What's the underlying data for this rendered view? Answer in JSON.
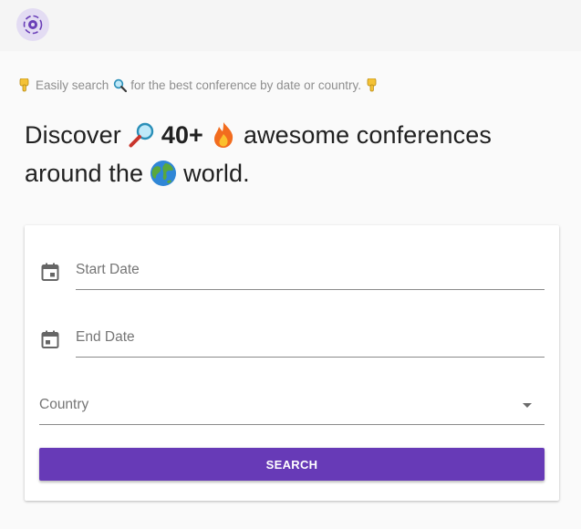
{
  "app": {
    "logo_icon": "atom-logo-icon",
    "accent_color": "#673ab7"
  },
  "tagline": {
    "part1": "Easily search",
    "part2": "for the best conference by date or country.",
    "icons": [
      "pointing-down-icon",
      "magnifier-icon",
      "pointing-down-icon"
    ]
  },
  "headline": {
    "word_discover": "Discover",
    "count": "40+",
    "word_awesome": "awesome conferences",
    "word_around": "around the",
    "word_world": "world.",
    "icons": [
      "magnifier-icon",
      "fire-icon",
      "globe-icon"
    ]
  },
  "form": {
    "start_date_placeholder": "Start Date",
    "end_date_placeholder": "End Date",
    "country_placeholder": "Country",
    "search_label": "SEARCH",
    "icons": [
      "calendar-icon",
      "calendar-icon",
      "dropdown-arrow-icon"
    ]
  }
}
